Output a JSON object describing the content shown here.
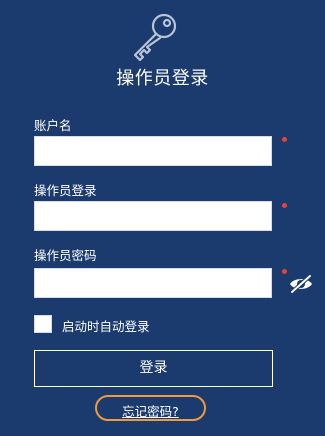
{
  "header": {
    "icon": "key-icon",
    "title": "操作员登录"
  },
  "form": {
    "account": {
      "label": "账户名",
      "value": "",
      "required": true
    },
    "operator": {
      "label": "操作员登录",
      "value": "",
      "required": true
    },
    "password": {
      "label": "操作员密码",
      "value": "",
      "required": true,
      "toggle_icon": "eye-slash-icon"
    },
    "auto_login": {
      "label": "启动时自动登录",
      "checked": false
    },
    "submit_label": "登录",
    "forgot_label": "忘记密码?"
  },
  "colors": {
    "background": "#1b3a6d",
    "required_dot": "#e0463e",
    "highlight": "#f09a3e",
    "icon_stroke": "#b9c4d8"
  }
}
